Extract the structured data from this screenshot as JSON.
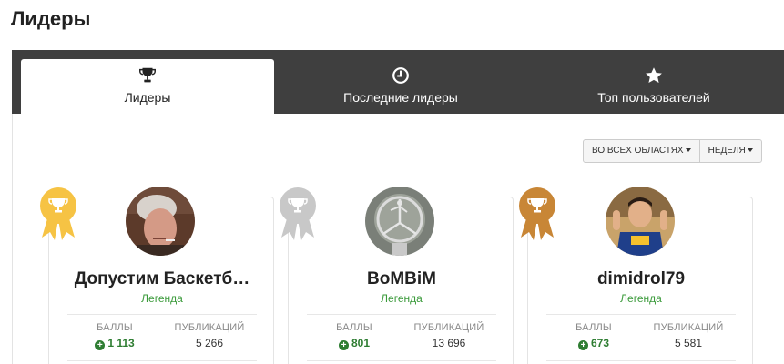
{
  "page": {
    "title": "Лидеры"
  },
  "tabs": [
    {
      "label": "Лидеры",
      "icon": "trophy-icon",
      "active": true
    },
    {
      "label": "Последние лидеры",
      "icon": "clock-icon",
      "active": false
    },
    {
      "label": "Топ пользователей",
      "icon": "star-icon",
      "active": false
    }
  ],
  "filters": {
    "scope": "ВО ВСЕХ ОБЛАСТЯХ",
    "period": "НЕДЕЛЯ"
  },
  "colors": {
    "gold": "#f6c344",
    "silver": "#c8c8c8",
    "bronze": "#c88636",
    "legend_green": "#3a9a3a",
    "points_green": "#2e7d32",
    "tab_bar": "#3f3f3f"
  },
  "leaders": [
    {
      "name": "Допустим Баскетб…",
      "rank": "Легенда",
      "points_label": "БАЛЛЫ",
      "points": "1 113",
      "posts_label": "ПУБЛИКАЦИЙ",
      "posts": "5 266",
      "medal": "gold"
    },
    {
      "name": "BoMBiM",
      "rank": "Легенда",
      "points_label": "БАЛЛЫ",
      "points": "801",
      "posts_label": "ПУБЛИКАЦИЙ",
      "posts": "13 696",
      "medal": "silver"
    },
    {
      "name": "dimidrol79",
      "rank": "Легенда",
      "points_label": "БАЛЛЫ",
      "points": "673",
      "posts_label": "ПУБЛИКАЦИЙ",
      "posts": "5 581",
      "medal": "bronze"
    }
  ]
}
